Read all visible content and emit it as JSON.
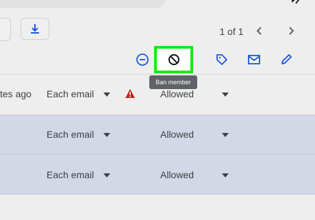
{
  "toolbar": {
    "pager_label": "1 of 1",
    "ban_tooltip": "Ban member"
  },
  "icons": {
    "download": "download-icon",
    "prev": "chevron-left-icon",
    "next": "chevron-right-icon",
    "remove": "minus-circle-icon",
    "ban": "ban-icon",
    "tag": "tag-icon",
    "mail": "mail-icon",
    "edit": "pencil-icon",
    "warning": "warning-icon"
  },
  "rows": [
    {
      "last_post": "tes ago",
      "delivery": "Each email",
      "posting": "Allowed",
      "has_warning": true
    },
    {
      "last_post": "",
      "delivery": "Each email",
      "posting": "Allowed",
      "has_warning": false
    },
    {
      "last_post": "",
      "delivery": "Each email",
      "posting": "Allowed",
      "has_warning": false
    }
  ],
  "colors": {
    "accent_blue": "#1a56db",
    "highlight_green": "#18e81a",
    "selected_row": "#d3d8e6",
    "warning_red": "#c5221f"
  }
}
